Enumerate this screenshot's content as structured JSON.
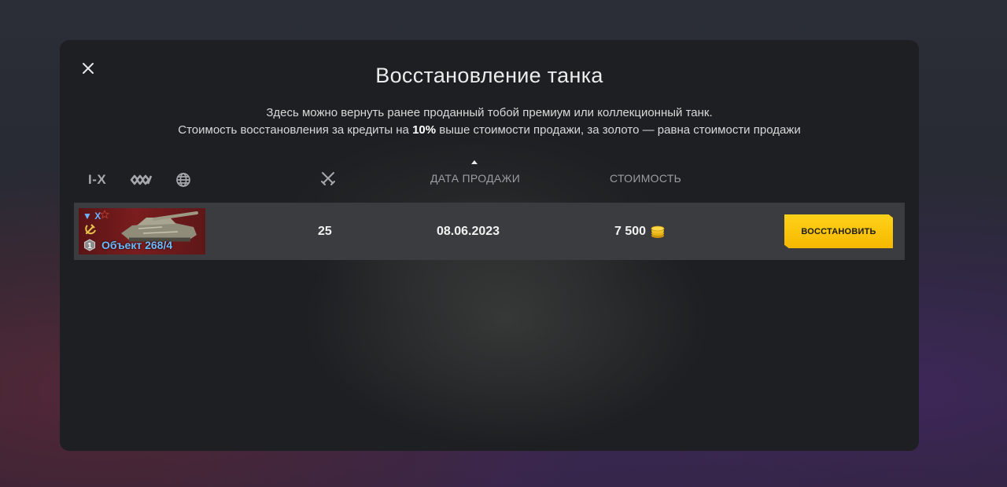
{
  "dialog": {
    "title": "Восстановление танка",
    "description_line1": "Здесь можно вернуть ранее проданный тобой премиум или коллекционный танк.",
    "description_line2_before": "Стоимость восстановления за кредиты на ",
    "description_line2_bold": "10%",
    "description_line2_after": " выше стоимости продажи, за золото — равна стоимости продажи"
  },
  "filters": {
    "tier_label": "I-X",
    "type_icon": "vehicle-type-icon",
    "nation_icon": "globe-icon"
  },
  "columns": {
    "battles_icon": "crossed-swords-icon",
    "date": "ДАТА ПРОДАЖИ",
    "date_sort": "ascending",
    "cost": "СТОИМОСТЬ"
  },
  "tanks": [
    {
      "type_tier": "▼ X",
      "name": "Объект 268/4",
      "mastery": "1",
      "nation": "ussr",
      "battles": "25",
      "sold_date": "08.06.2023",
      "price": "7 500",
      "currency_icon": "gold-coins-icon",
      "action_label": "ВОССТАНОВИТЬ"
    }
  ],
  "colors": {
    "accent": "#ffcc00",
    "tank_name": "#6bbcff",
    "row_bg": "#3a3c3f",
    "modal_bg": "#1d1f22"
  }
}
